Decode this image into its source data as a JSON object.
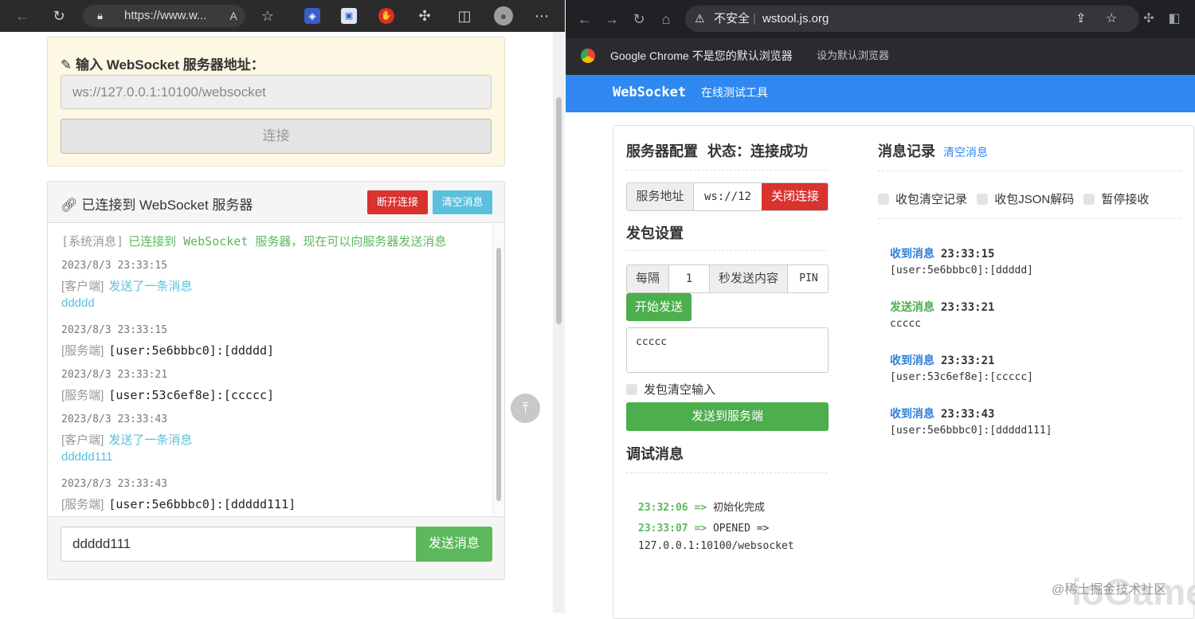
{
  "left": {
    "url": "https://www.w...",
    "config": {
      "title": "输入 WebSocket 服务器地址：",
      "url_value": "ws://127.0.0.1:10100/websocket",
      "connect_label": "连接"
    },
    "panel": {
      "title": "已连接到 WebSocket 服务器",
      "disconnect_label": "断开连接",
      "clear_label": "清空消息",
      "messages": [
        {
          "tag": "[系统消息]",
          "text": "已连接到 WebSocket 服务器，现在可以向服务器发送消息"
        },
        {
          "time": "2023/8/3 23:33:15",
          "tag": "[客户端]",
          "text": "发送了一条消息",
          "body": "ddddd"
        },
        {
          "time": "2023/8/3 23:33:15",
          "tag": "[服务端]",
          "text": "[user:5e6bbbc0]:[ddddd]"
        },
        {
          "time": "2023/8/3 23:33:21",
          "tag": "[服务端]",
          "text": "[user:53c6ef8e]:[ccccc]"
        },
        {
          "time": "2023/8/3 23:33:43",
          "tag": "[客户端]",
          "text": "发送了一条消息",
          "body": "ddddd111"
        },
        {
          "time": "2023/8/3 23:33:43",
          "tag": "[服务端]",
          "text": "[user:5e6bbbc0]:[ddddd111]"
        }
      ],
      "input_value": "ddddd111",
      "send_label": "发送消息"
    }
  },
  "right": {
    "security": "不安全",
    "url": "wstool.js.org",
    "infobar": {
      "text": "Google Chrome 不是您的默认浏览器",
      "action": "设为默认浏览器"
    },
    "brand": "WebSocket",
    "brand_sub": "在线测试工具",
    "server": {
      "title": "服务器配置",
      "status": "状态：连接成功",
      "addr_label": "服务地址",
      "addr_value": "ws://12",
      "close_label": "关闭连接"
    },
    "send": {
      "title": "发包设置",
      "every_label": "每隔",
      "every_value": "1",
      "per_label": "秒发送内容",
      "content_value": "PIN",
      "start_label": "开始发送",
      "textarea": "ccccc",
      "clear_after": "发包清空输入",
      "send_label": "发送到服务端"
    },
    "debug": {
      "title": "调试消息",
      "lines": [
        {
          "time": "23:32:06",
          "arrow": "=>",
          "text": "初始化完成"
        },
        {
          "time": "23:33:07",
          "arrow": "=>",
          "text": "OPENED =>",
          "text2": "127.0.0.1:10100/websocket"
        }
      ]
    },
    "log": {
      "title": "消息记录",
      "clear_label": "清空消息",
      "options": [
        "收包清空记录",
        "收包JSON解码",
        "暂停接收"
      ],
      "entries": [
        {
          "type": "收到消息",
          "time": "23:33:15",
          "text": "[user:5e6bbbc0]:[ddddd]",
          "color": "#2f7fd8"
        },
        {
          "type": "发送消息",
          "time": "23:33:21",
          "text": "ccccc",
          "color": "#4cae4c"
        },
        {
          "type": "收到消息",
          "time": "23:33:21",
          "text": "[user:53c6ef8e]:[ccccc]",
          "color": "#2f7fd8"
        },
        {
          "type": "收到消息",
          "time": "23:33:43",
          "text": "[user:5e6bbbc0]:[ddddd111]",
          "color": "#2f7fd8"
        }
      ]
    }
  },
  "watermark": "@稀土掘金技术社区",
  "watermark2": "ioGame"
}
